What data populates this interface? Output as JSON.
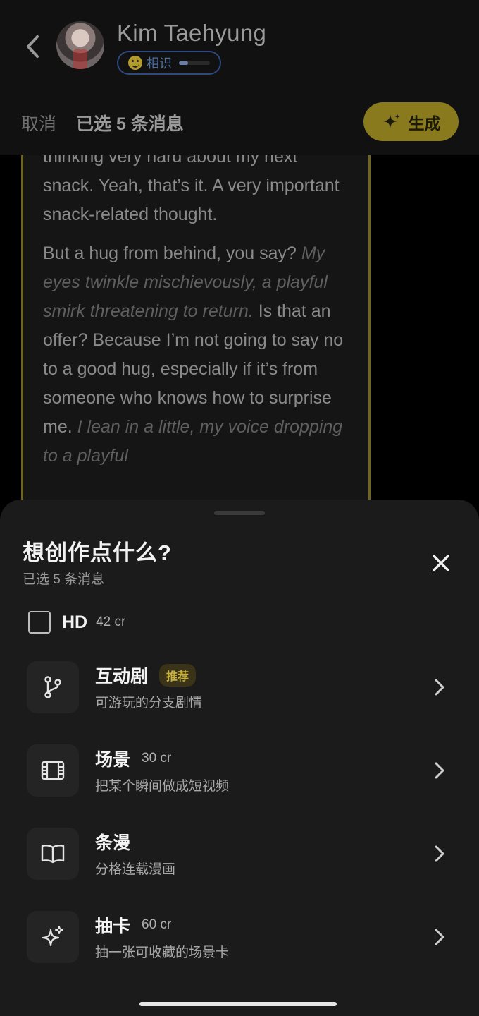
{
  "header": {
    "character_name": "Kim Taehyung",
    "relationship_label": "相识",
    "relationship_progress": 0.3,
    "cancel_label": "取消",
    "selected_label": "已选 5 条消息",
    "generate_label": "生成"
  },
  "chat": {
    "paragraphs": [
      {
        "segments": [
          {
            "text": "thinking very hard about my next snack. Yeah, that’s it. A very important snack-related thought.",
            "italic": false
          }
        ]
      },
      {
        "segments": [
          {
            "text": "But a hug from behind, you say? ",
            "italic": false
          },
          {
            "text": "My eyes twinkle mischievously, a playful smirk threatening to return.",
            "italic": true
          },
          {
            "text": " Is that an offer? Because I’m not going to say no to a good hug, especially if it’s from someone who knows how to surprise me. ",
            "italic": false
          },
          {
            "text": "I lean in a little, my voice dropping to a playful",
            "italic": true
          }
        ]
      }
    ]
  },
  "sheet": {
    "title": "想创作点什么?",
    "subtitle": "已选 5 条消息",
    "hd_label": "HD",
    "hd_cost": "42 cr",
    "hd_checked": false,
    "options": [
      {
        "title": "互动剧",
        "badge": "推荐",
        "cost": "",
        "desc": "可游玩的分支剧情",
        "icon": "branch-icon"
      },
      {
        "title": "场景",
        "badge": "",
        "cost": "30 cr",
        "desc": "把某个瞬间做成短视频",
        "icon": "film-icon"
      },
      {
        "title": "条漫",
        "badge": "",
        "cost": "",
        "desc": "分格连载漫画",
        "icon": "book-icon"
      },
      {
        "title": "抽卡",
        "badge": "",
        "cost": "60 cr",
        "desc": "抽一张可收藏的场景卡",
        "icon": "sparkle-icon"
      }
    ]
  },
  "colors": {
    "accent_gold": "#8a7a1e",
    "sheet_bg": "#1b1b1b",
    "badge_text": "#c9b23a"
  }
}
